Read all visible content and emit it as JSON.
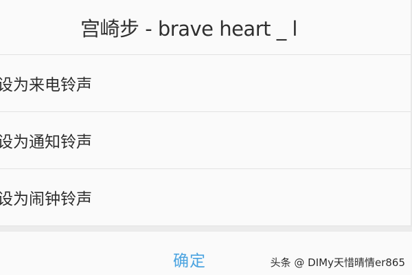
{
  "dialog": {
    "title": "宫崎步 - brave heart _ l"
  },
  "options": [
    {
      "label": "设为来电铃声"
    },
    {
      "label": "设为通知铃声"
    },
    {
      "label": "设为闹钟铃声"
    }
  ],
  "buttons": {
    "confirm_label": "确定"
  },
  "watermark": {
    "text": "头条 @ ꓓꓲMy天惜晴情er865"
  },
  "colors": {
    "accent": "#4aa3e0",
    "background": "#fafafa",
    "divider": "#e2e2e2"
  }
}
